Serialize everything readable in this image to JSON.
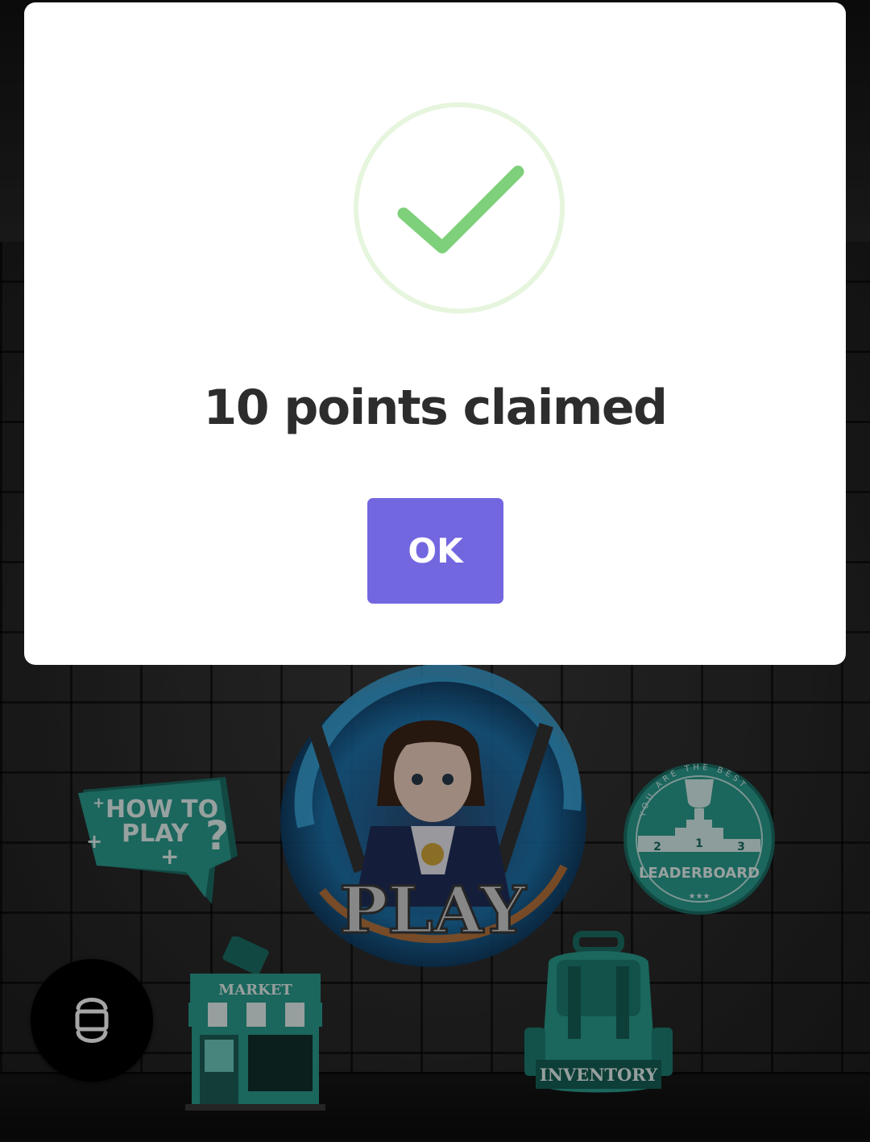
{
  "modal": {
    "message": "10 points claimed",
    "ok_label": "OK",
    "icon": "check-circle-icon",
    "accent_color": "#7367e0",
    "success_color": "#7ed07a"
  },
  "menu": {
    "how_to_play": {
      "line1": "HOW TO",
      "line2": "PLAY",
      "mark": "?"
    },
    "play": {
      "label": "PLAY"
    },
    "leaderboard": {
      "label": "LEADERBOARD",
      "arc_text": "YOU ARE THE BEST",
      "podium": [
        "2",
        "1",
        "3"
      ],
      "stars": "★★★"
    },
    "market": {
      "label": "MARKET"
    },
    "inventory": {
      "label": "INVENTORY"
    }
  },
  "controls": {
    "screen_toggle_icon": "screen-rotate-icon"
  }
}
